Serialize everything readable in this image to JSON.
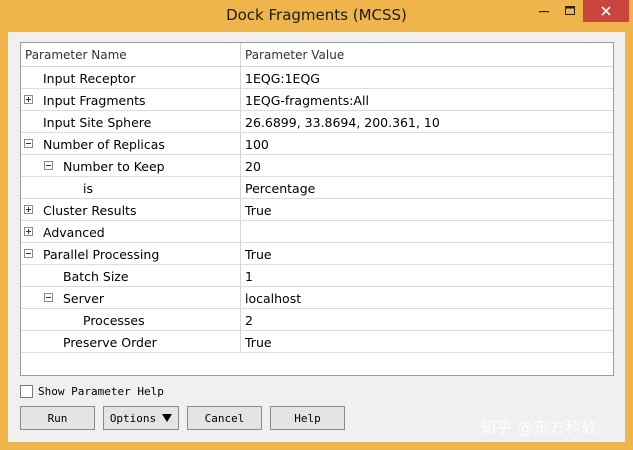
{
  "window": {
    "title": "Dock Fragments (MCSS)"
  },
  "grid": {
    "header": {
      "name": "Parameter Name",
      "value": "Parameter Value"
    },
    "rows": [
      {
        "name": "Input Receptor",
        "value": "1EQG:1EQG"
      },
      {
        "name": "Input Fragments",
        "value": "1EQG-fragments:All"
      },
      {
        "name": "Input Site Sphere",
        "value": "26.6899, 33.8694, 200.361, 10"
      },
      {
        "name": "Number of Replicas",
        "value": "100"
      },
      {
        "name": "Number to Keep",
        "value": "20"
      },
      {
        "name": "is",
        "value": "Percentage"
      },
      {
        "name": "Cluster Results",
        "value": "True"
      },
      {
        "name": "Advanced",
        "value": ""
      },
      {
        "name": "Parallel Processing",
        "value": "True"
      },
      {
        "name": "Batch Size",
        "value": "1"
      },
      {
        "name": "Server",
        "value": "localhost"
      },
      {
        "name": "Processes",
        "value": "2"
      },
      {
        "name": "Preserve Order",
        "value": "True"
      }
    ]
  },
  "options": {
    "show_help_label": "Show Parameter Help"
  },
  "buttons": {
    "run": "Run",
    "options": "Options",
    "cancel": "Cancel",
    "help": "Help"
  },
  "watermark": "知乎 @东方科软"
}
